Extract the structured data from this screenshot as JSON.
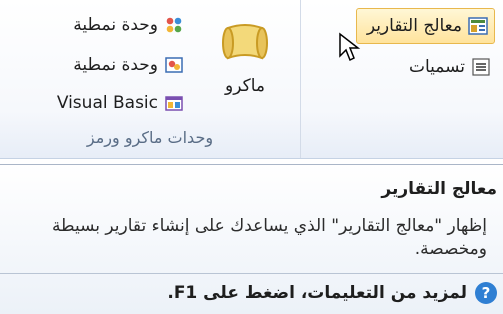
{
  "ribbon": {
    "report_wizard_label": "معالج التقارير",
    "names_label": "تسميات",
    "macro_label": "ماكرو",
    "module_label": "وحدة نمطية",
    "class_module_label": "وحدة نمطية",
    "vba_label": "Visual Basic",
    "group_label": "وحدات ماكرو ورمز"
  },
  "tooltip": {
    "title": "معالج التقارير",
    "description": "إظهار \"معالج التقارير\" الذي يساعدك على إنشاء تقارير بسيطة ومخصصة.",
    "help_text": "لمزيد من التعليمات، اضغط على F1."
  }
}
